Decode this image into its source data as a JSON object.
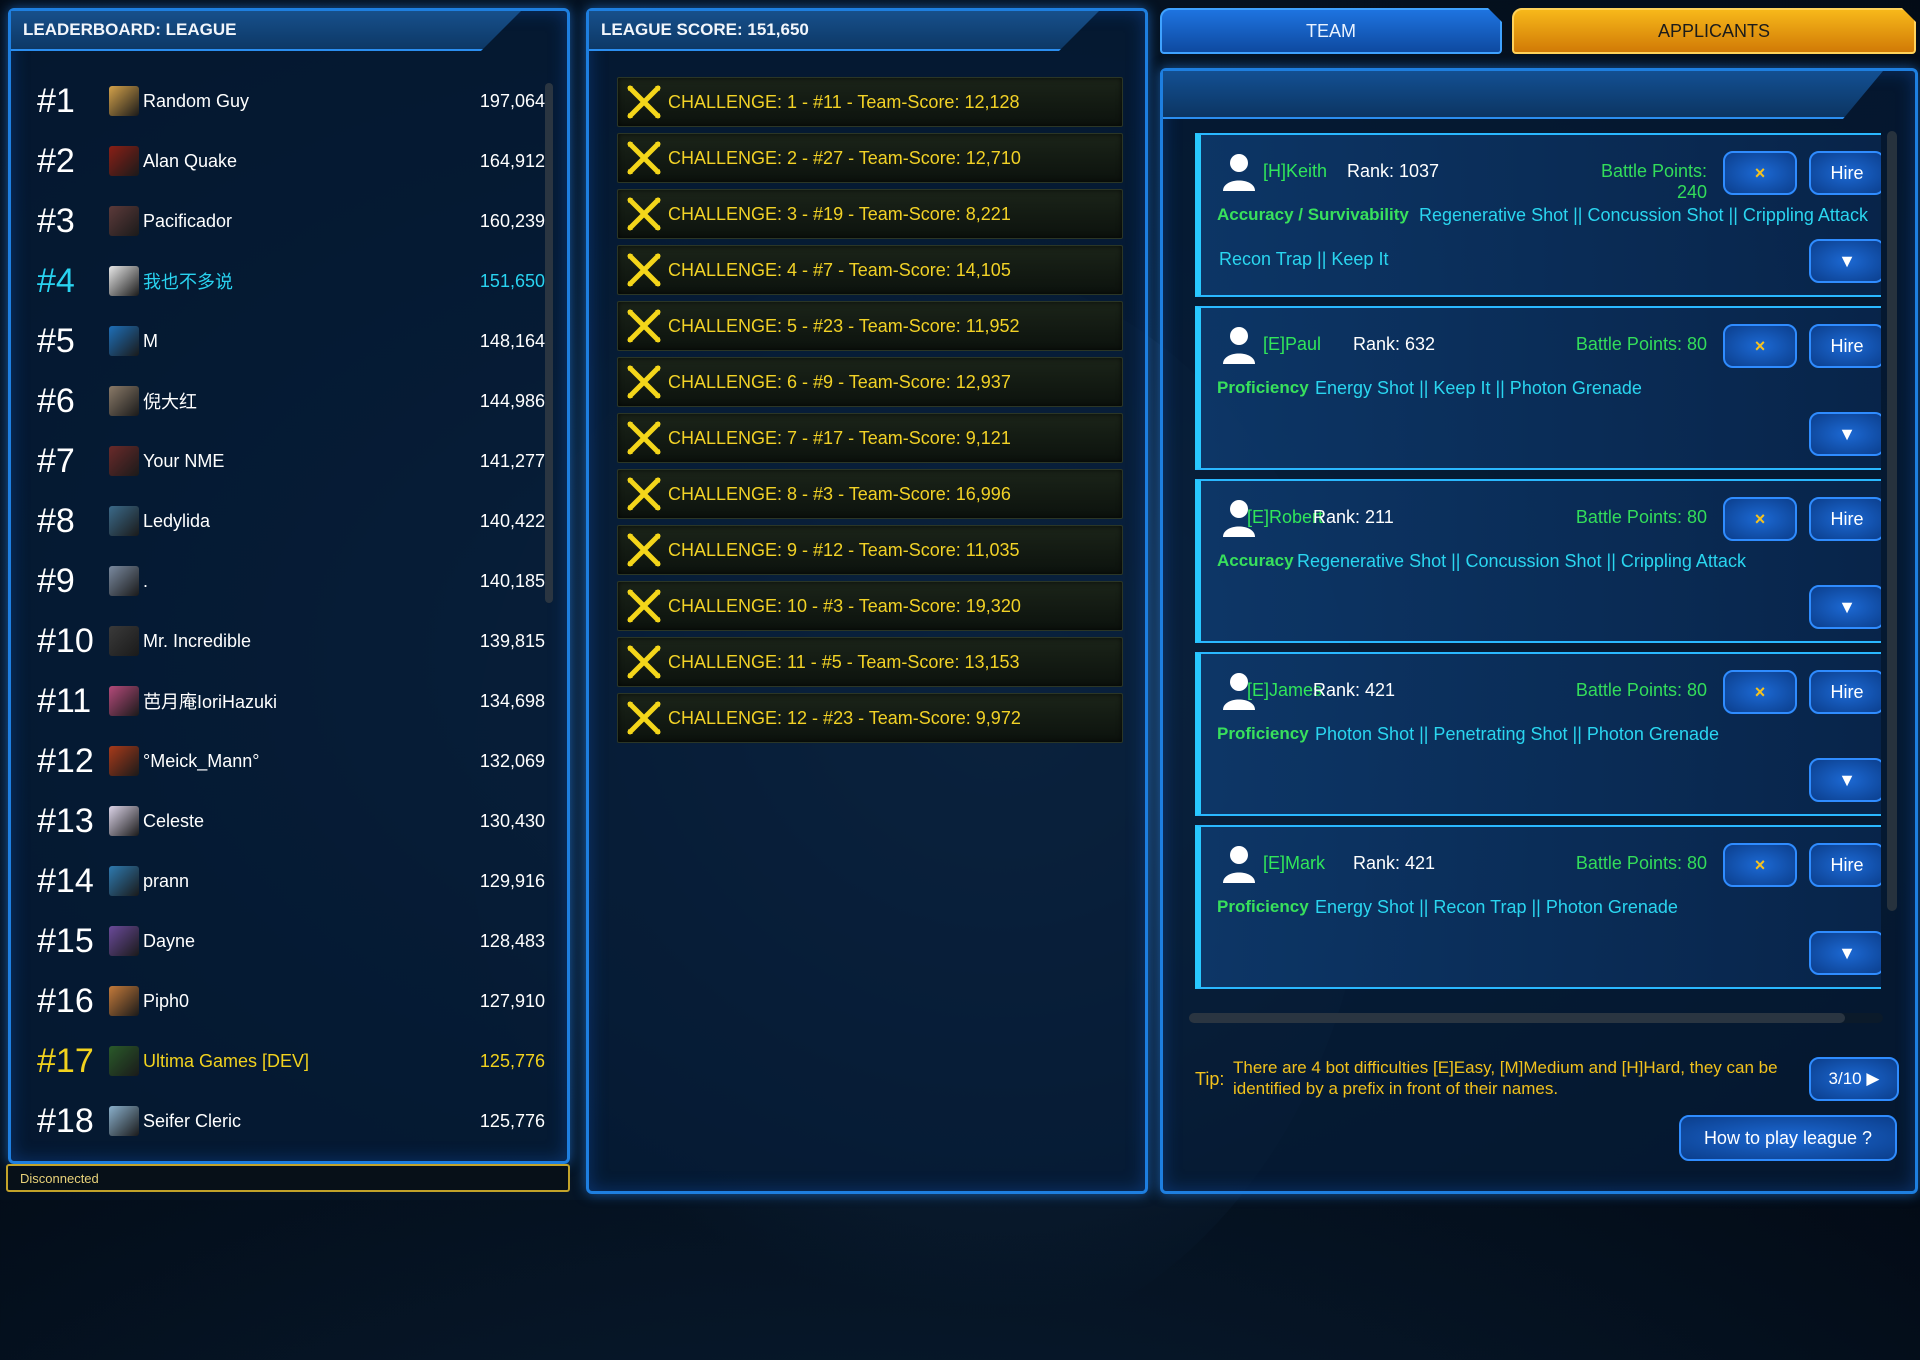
{
  "leaderboard": {
    "title": "LEADERBOARD: LEAGUE",
    "rows": [
      {
        "rank": "#1",
        "name": "Random Guy",
        "score": "197,064",
        "avatar_color": "#d4a24a"
      },
      {
        "rank": "#2",
        "name": "Alan Quake",
        "score": "164,912",
        "avatar_color": "#8a1f16"
      },
      {
        "rank": "#3",
        "name": "Pacificador",
        "score": "160,239",
        "avatar_color": "#5c3a3a"
      },
      {
        "rank": "#4",
        "name": "我也不多说",
        "score": "151,650",
        "avatar_color": "#e8e8e8"
      },
      {
        "rank": "#5",
        "name": "M",
        "score": "148,164",
        "avatar_color": "#1e6fb8"
      },
      {
        "rank": "#6",
        "name": "倪大红",
        "score": "144,986",
        "avatar_color": "#8a7a68"
      },
      {
        "rank": "#7",
        "name": "Your NME",
        "score": "141,277",
        "avatar_color": "#6a2a2a"
      },
      {
        "rank": "#8",
        "name": "Ledylida",
        "score": "140,422",
        "avatar_color": "#3b6a8a"
      },
      {
        "rank": "#9",
        "name": ".",
        "score": "140,185",
        "avatar_color": "#7a8aa0"
      },
      {
        "rank": "#10",
        "name": "Mr. Incredible",
        "score": "139,815",
        "avatar_color": "#3a3a3a"
      },
      {
        "rank": "#11",
        "name": "芭月庵IoriHazuki",
        "score": "134,698",
        "avatar_color": "#b44a7a"
      },
      {
        "rank": "#12",
        "name": "°Meick_Mann°",
        "score": "132,069",
        "avatar_color": "#a83a1a"
      },
      {
        "rank": "#13",
        "name": "Celeste",
        "score": "130,430",
        "avatar_color": "#dcd4e8"
      },
      {
        "rank": "#14",
        "name": "prann",
        "score": "129,916",
        "avatar_color": "#2e7ab0"
      },
      {
        "rank": "#15",
        "name": "Dayne",
        "score": "128,483",
        "avatar_color": "#6a4a9a"
      },
      {
        "rank": "#16",
        "name": "Piph0",
        "score": "127,910",
        "avatar_color": "#c47a3a"
      },
      {
        "rank": "#17",
        "name": "Ultima Games [DEV]",
        "score": "125,776",
        "avatar_color": "#2a5a2a"
      },
      {
        "rank": "#18",
        "name": "Seifer Cleric",
        "score": "125,776",
        "avatar_color": "#8ab0cc"
      }
    ]
  },
  "status": {
    "text": "Disconnected"
  },
  "league": {
    "title": "LEAGUE SCORE: 151,650",
    "challenges": [
      "CHALLENGE: 1 - #11 -  Team-Score: 12,128",
      "CHALLENGE: 2 - #27 -  Team-Score: 12,710",
      "CHALLENGE: 3 - #19 -  Team-Score: 8,221",
      "CHALLENGE: 4 - #7 -  Team-Score: 14,105",
      "CHALLENGE: 5 - #23 -  Team-Score: 11,952",
      "CHALLENGE: 6 - #9 -  Team-Score: 12,937",
      "CHALLENGE: 7 - #17 -  Team-Score: 9,121",
      "CHALLENGE: 8 - #3 -  Team-Score: 16,996",
      "CHALLENGE: 9 - #12 -  Team-Score: 11,035",
      "CHALLENGE: 10 - #3 -  Team-Score: 19,320",
      "CHALLENGE: 11 - #5 -  Team-Score: 13,153",
      "CHALLENGE: 12 - #23 -  Team-Score: 9,972"
    ]
  },
  "tabs": {
    "team": "TEAM",
    "applicants": "APPLICANTS"
  },
  "applicants": [
    {
      "name": "[H]Keith",
      "rank": "Rank: 1037",
      "battle_points": "Battle Points: 240",
      "cls": "Accuracy / Survivability",
      "skills": "Regenerative Shot || Concussion Shot || Crippling Attack",
      "skills2": "Recon Trap || Keep It"
    },
    {
      "name": "[E]Paul",
      "rank": "Rank: 632",
      "battle_points": "Battle Points: 80",
      "cls": "Proficiency",
      "skills": "Energy Shot || Keep It || Photon Grenade",
      "skills2": ""
    },
    {
      "name": "[E]Robert",
      "rank": "Rank: 211",
      "battle_points": "Battle Points: 80",
      "cls": "Accuracy",
      "skills": "Regenerative Shot || Concussion Shot || Crippling Attack",
      "skills2": ""
    },
    {
      "name": "[E]James",
      "rank": "Rank: 421",
      "battle_points": "Battle Points: 80",
      "cls": "Proficiency",
      "skills": "Photon Shot || Penetrating Shot || Photon Grenade",
      "skills2": ""
    },
    {
      "name": "[E]Mark",
      "rank": "Rank: 421",
      "battle_points": "Battle Points: 80",
      "cls": "Proficiency",
      "skills": "Energy Shot || Recon Trap || Photon Grenade",
      "skills2": ""
    }
  ],
  "buttons": {
    "reject": "×",
    "hire": "Hire",
    "expand": "▼",
    "how_to": "How to play league ?"
  },
  "tip": {
    "label": "Tip:",
    "text": "There are 4 bot difficulties [E]Easy, [M]Medium and [H]Hard, they can be identified by a prefix in front of their names.",
    "page": "3/10 ▶"
  }
}
